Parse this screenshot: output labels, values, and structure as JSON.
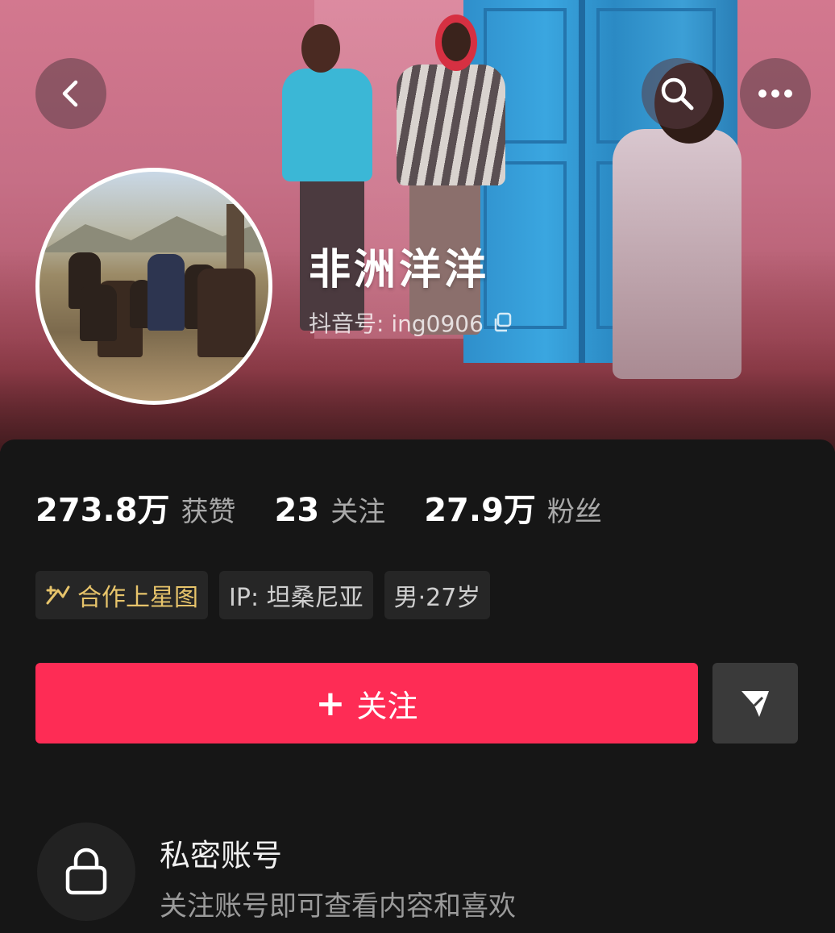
{
  "profile": {
    "display_name": "非洲洋洋",
    "douyin_id": "抖音号: ing0906"
  },
  "header": {
    "icons": {
      "back": "chevron-left-icon",
      "search": "search-icon",
      "more": "more-horizontal-icon",
      "copy": "copy-icon"
    }
  },
  "stats": [
    {
      "value": "273.8万",
      "label": "获赞"
    },
    {
      "value": "23",
      "label": "关注"
    },
    {
      "value": "27.9万",
      "label": "粉丝"
    }
  ],
  "tags": {
    "star": "合作上星图",
    "ip": "IP: 坦桑尼亚",
    "gender_age": "男·27岁"
  },
  "actions": {
    "follow_plus": "+",
    "follow_label": "关注",
    "share_icon": "send-icon"
  },
  "private": {
    "title": "私密账号",
    "description": "关注账号即可查看内容和喜欢",
    "icon": "lock-icon"
  },
  "colors": {
    "follow": "#fe2c55",
    "star_tag": "#e7c46b",
    "background": "#161616"
  }
}
